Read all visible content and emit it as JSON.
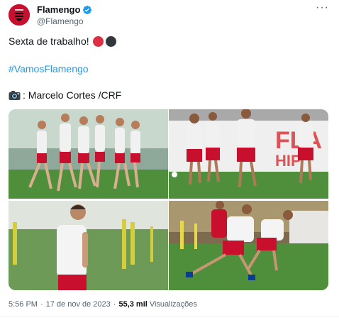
{
  "author": {
    "display_name": "Flamengo",
    "handle": "@Flamengo",
    "verified": true,
    "avatar_icon": "flamengo-crest-icon"
  },
  "header": {
    "more_label": "···"
  },
  "tweet": {
    "line1": "Sexta de trabalho!",
    "line1_emojis": [
      "red-circle",
      "black-circle"
    ],
    "hashtag": "#VamosFlamengo",
    "credit": ": Marcelo Cortes /CRF",
    "credit_icon": "camera-icon"
  },
  "media": {
    "count": 4
  },
  "meta": {
    "time": "5:56 PM",
    "separator": "·",
    "date": "17 de nov de 2023",
    "views_count": "55,3 mil",
    "views_label": "Visualizações"
  },
  "colors": {
    "brand_red": "#c8102e",
    "link_blue": "#1d9bf0",
    "verified_blue": "#1d9bf0",
    "muted": "#536471",
    "emoji_red": "#dd2e44",
    "emoji_black": "#31373d"
  }
}
